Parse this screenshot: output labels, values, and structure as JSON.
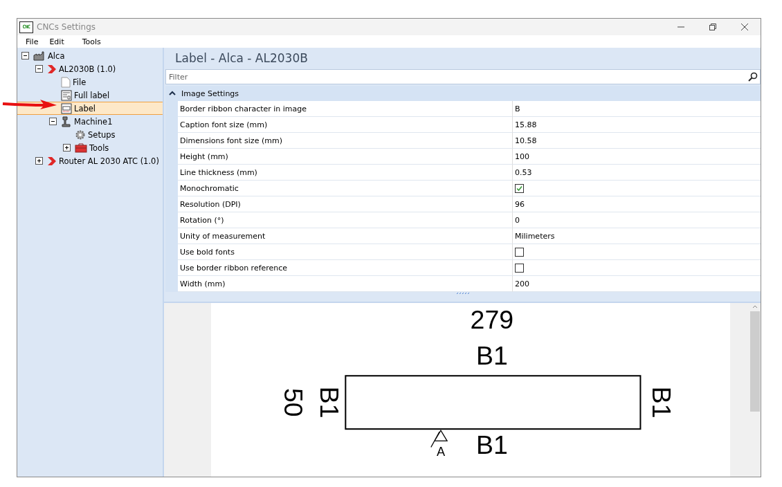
{
  "window": {
    "title": "CNCs Settings",
    "logo": "CNC"
  },
  "menu": [
    "File",
    "Edit",
    "Tools"
  ],
  "tree": [
    {
      "label": "Alca",
      "kind": "factory",
      "expanded": true,
      "selected": false,
      "children": [
        {
          "label": "AL2030B (1.0)",
          "kind": "model",
          "expanded": true,
          "selected": false,
          "children": [
            {
              "label": "File",
              "kind": "page",
              "selected": false
            },
            {
              "label": "Full label",
              "kind": "document",
              "selected": false
            },
            {
              "label": "Label",
              "kind": "label",
              "selected": true
            },
            {
              "label": "Machine1",
              "kind": "machine",
              "expanded": true,
              "selected": false,
              "children": [
                {
                  "label": "Setups",
                  "kind": "gear",
                  "selected": false
                },
                {
                  "label": "Tools",
                  "kind": "toolbox",
                  "expanded": false,
                  "selected": false
                }
              ]
            }
          ]
        },
        {
          "label": "Router AL 2030 ATC (1.0)",
          "kind": "model",
          "expanded": false,
          "selected": false
        }
      ]
    }
  ],
  "panel": {
    "title": "Label - Alca - AL2030B",
    "filter": {
      "placeholder": "Filter"
    },
    "category": {
      "label": "Image Settings",
      "expanded": true
    },
    "properties": [
      {
        "name": "Border ribbon character in image",
        "kind": "text",
        "value": "B"
      },
      {
        "name": "Caption font size (mm)",
        "kind": "text",
        "value": "15.88"
      },
      {
        "name": "Dimensions font size (mm)",
        "kind": "text",
        "value": "10.58"
      },
      {
        "name": "Height (mm)",
        "kind": "text",
        "value": "100"
      },
      {
        "name": "Line thickness (mm)",
        "kind": "text",
        "value": "0.53"
      },
      {
        "name": "Monochromatic",
        "kind": "checkbox",
        "checked": true
      },
      {
        "name": "Resolution (DPI)",
        "kind": "text",
        "value": "96"
      },
      {
        "name": "Rotation (°)",
        "kind": "text",
        "value": "0"
      },
      {
        "name": "Unity of measurement",
        "kind": "text",
        "value": "Milimeters"
      },
      {
        "name": "Use bold fonts",
        "kind": "checkbox",
        "checked": false
      },
      {
        "name": "Use border ribbon reference",
        "kind": "checkbox",
        "checked": false
      },
      {
        "name": "Width (mm)",
        "kind": "text",
        "value": "200"
      }
    ]
  },
  "preview": {
    "width_label": "279",
    "height_label": "50",
    "top_ribbon": "B1",
    "left_ribbon": "B1",
    "right_ribbon": "B1",
    "bottom_ribbon": "B1",
    "origin_mark": "A"
  }
}
